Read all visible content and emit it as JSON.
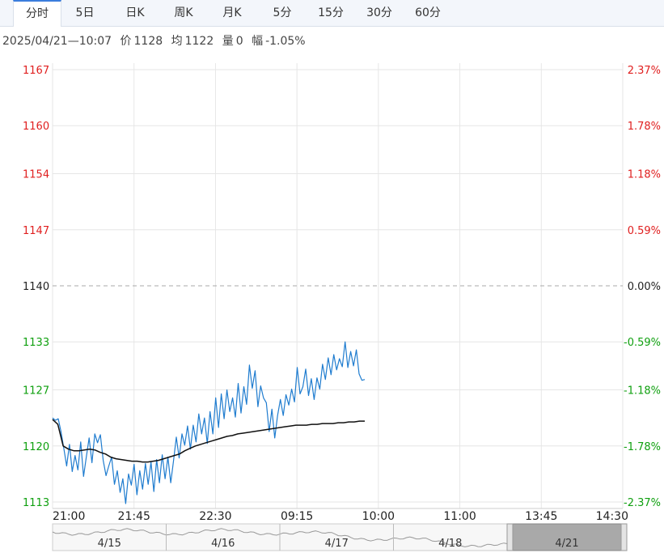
{
  "tabs": [
    {
      "label": "分时",
      "active": true
    },
    {
      "label": "5日"
    },
    {
      "label": "日K"
    },
    {
      "label": "周K"
    },
    {
      "label": "月K"
    },
    {
      "label": "5分"
    },
    {
      "label": "15分"
    },
    {
      "label": "30分"
    },
    {
      "label": "60分"
    }
  ],
  "info": {
    "time": "2025/04/21—10:07",
    "price_label": "价",
    "price": "1128",
    "avg_label": "均",
    "avg": "1122",
    "vol_label": "量",
    "vol": "0",
    "chg_label": "幅",
    "chg": "-1.05%"
  },
  "colors": {
    "up": "#e02020",
    "down": "#10a010",
    "neutral": "#222222",
    "price_line": "#1f7ccf",
    "avg_line": "#111111",
    "grid": "#e6e6e6"
  },
  "chart_data": {
    "type": "line",
    "prev_close": 1140,
    "ylim": [
      1113,
      1167
    ],
    "y_ticks": [
      {
        "label": "1167",
        "pct": "2.37%",
        "tone": "up",
        "v": 1167
      },
      {
        "label": "1160",
        "pct": "1.78%",
        "tone": "up",
        "v": 1160
      },
      {
        "label": "1154",
        "pct": "1.18%",
        "tone": "up",
        "v": 1154
      },
      {
        "label": "1147",
        "pct": "0.59%",
        "tone": "up",
        "v": 1147
      },
      {
        "label": "1140",
        "pct": "0.00%",
        "tone": "neutral",
        "v": 1140
      },
      {
        "label": "1133",
        "pct": "-0.59%",
        "tone": "down",
        "v": 1133
      },
      {
        "label": "1127",
        "pct": "-1.18%",
        "tone": "down",
        "v": 1127
      },
      {
        "label": "1120",
        "pct": "-1.78%",
        "tone": "down",
        "v": 1120
      },
      {
        "label": "1113",
        "pct": "-2.37%",
        "tone": "down",
        "v": 1113
      }
    ],
    "x_labels": [
      "21:00",
      "21:45",
      "22:30",
      "09:15",
      "10:00",
      "11:00",
      "13:45",
      "14:30"
    ],
    "grid": true,
    "series": [
      {
        "role": "price",
        "values": [
          1123.5,
          1123.2,
          1123.4,
          1121.8,
          1119.7,
          1117.5,
          1120.2,
          1116.8,
          1118.8,
          1117.0,
          1120.5,
          1116.2,
          1118.6,
          1121.0,
          1117.9,
          1121.5,
          1120.4,
          1121.4,
          1118.2,
          1116.3,
          1117.5,
          1118.6,
          1115.2,
          1116.9,
          1114.2,
          1115.9,
          1112.8,
          1116.5,
          1115.1,
          1117.7,
          1113.9,
          1116.9,
          1114.6,
          1117.8,
          1115.2,
          1118.0,
          1114.3,
          1118.3,
          1115.4,
          1118.9,
          1115.9,
          1118.6,
          1115.4,
          1118.1,
          1121.1,
          1118.5,
          1121.5,
          1120.1,
          1122.5,
          1119.6,
          1122.6,
          1120.5,
          1124.0,
          1121.5,
          1123.5,
          1120.3,
          1124.3,
          1121.5,
          1126.0,
          1122.3,
          1126.5,
          1123.4,
          1127.0,
          1124.3,
          1126.0,
          1123.6,
          1127.8,
          1124.1,
          1127.4,
          1125.2,
          1130.1,
          1127.2,
          1129.4,
          1124.9,
          1127.5,
          1126.0,
          1125.4,
          1121.8,
          1124.6,
          1121.0,
          1123.8,
          1125.8,
          1123.8,
          1126.4,
          1125.1,
          1127.1,
          1125.5,
          1129.8,
          1126.5,
          1127.4,
          1129.6,
          1126.3,
          1128.4,
          1125.8,
          1128.5,
          1127.1,
          1130.2,
          1128.3,
          1131.0,
          1128.9,
          1131.4,
          1129.5,
          1130.9,
          1129.9,
          1133.0,
          1129.8,
          1131.8,
          1130.0,
          1132.0,
          1129.0,
          1128.2,
          1128.3
        ]
      },
      {
        "role": "avg",
        "values": [
          1123.3,
          1122.7,
          1120.0,
          1119.6,
          1119.4,
          1119.4,
          1119.5,
          1119.6,
          1119.5,
          1119.2,
          1119.0,
          1118.6,
          1118.4,
          1118.3,
          1118.2,
          1118.1,
          1118.1,
          1118.0,
          1118.0,
          1118.1,
          1118.2,
          1118.4,
          1118.6,
          1118.8,
          1119.0,
          1119.4,
          1119.7,
          1120.0,
          1120.2,
          1120.4,
          1120.6,
          1120.8,
          1121.0,
          1121.2,
          1121.3,
          1121.5,
          1121.6,
          1121.7,
          1121.8,
          1121.9,
          1122.0,
          1122.1,
          1122.2,
          1122.3,
          1122.4,
          1122.5,
          1122.6,
          1122.6,
          1122.6,
          1122.7,
          1122.7,
          1122.8,
          1122.8,
          1122.8,
          1122.9,
          1122.9,
          1123.0,
          1123.0,
          1123.1,
          1123.1
        ]
      }
    ]
  },
  "navigator": {
    "labels": [
      "4/15",
      "4/16",
      "4/17",
      "4/18",
      "4/21"
    ],
    "selected": "4/21"
  }
}
